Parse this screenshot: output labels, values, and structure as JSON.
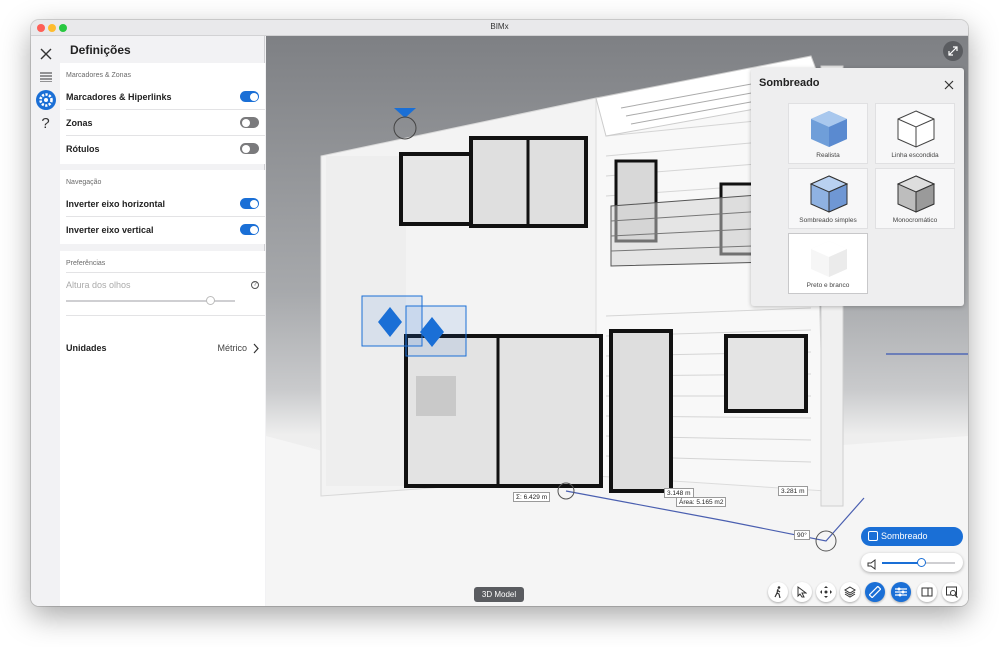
{
  "window": {
    "title": "BIMx"
  },
  "panel": {
    "title": "Definições",
    "section_markers": "Marcadores & Zonas",
    "markers_label": "Marcadores & Hiperlinks",
    "zones_label": "Zonas",
    "labels_label": "Rótulos",
    "section_navigation": "Navegação",
    "invert_h_label": "Inverter eixo horizontal",
    "invert_v_label": "Inverter eixo vertical",
    "section_preferences": "Preferências",
    "eye_height_label": "Altura dos olhos",
    "eye_height_level": 0.85,
    "units_label": "Unidades",
    "units_value": "Métrico",
    "toggles": {
      "markers": true,
      "zones": false,
      "labels": false,
      "invert_h": true,
      "invert_v": true
    }
  },
  "shading": {
    "title": "Sombreado",
    "options": [
      "Realista",
      "Linha escondida",
      "Sombreado simples",
      "Monocromático",
      "Preto e branco"
    ]
  },
  "controls": {
    "shade_button": "Sombreado",
    "mode_tag": "3D Model"
  },
  "measurements": {
    "sum": "Σ: 6.429 m",
    "seg1": "3.148 m",
    "area": "Área: 5.165 m2",
    "seg2": "3.281 m",
    "angle": "90°"
  },
  "colors": {
    "accent": "#1a6fd6",
    "toggle_off": "#7a7a7c"
  }
}
